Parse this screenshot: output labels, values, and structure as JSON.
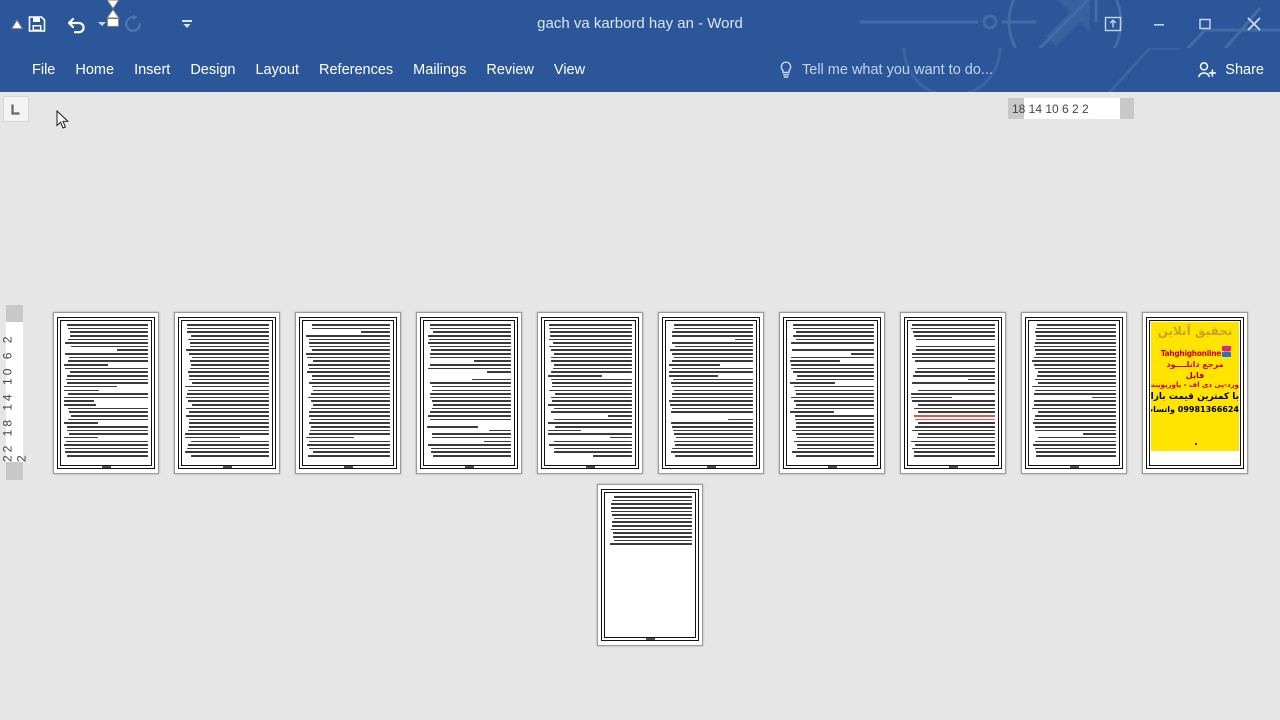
{
  "window": {
    "title": "gach va karbord hay an - Word",
    "accent_color": "#2b579a",
    "canvas_color": "#e6e6e6"
  },
  "quick_access": {
    "items": [
      {
        "name": "save-icon",
        "label": "Save",
        "enabled": true
      },
      {
        "name": "undo-icon",
        "label": "Undo",
        "enabled": true
      },
      {
        "name": "redo-icon",
        "label": "Redo",
        "enabled": false
      },
      {
        "name": "customize-quick-access-icon",
        "label": "Customize Quick Access Toolbar",
        "enabled": true
      }
    ]
  },
  "window_controls": [
    {
      "name": "ribbon-display-options-icon",
      "label": "Ribbon Display Options"
    },
    {
      "name": "minimize-icon",
      "label": "Minimize"
    },
    {
      "name": "restore-icon",
      "label": "Restore Down"
    },
    {
      "name": "close-icon",
      "label": "Close"
    }
  ],
  "ribbon": {
    "tabs": [
      {
        "label": "File"
      },
      {
        "label": "Home"
      },
      {
        "label": "Insert"
      },
      {
        "label": "Design"
      },
      {
        "label": "Layout"
      },
      {
        "label": "References"
      },
      {
        "label": "Mailings"
      },
      {
        "label": "Review"
      },
      {
        "label": "View"
      }
    ],
    "tell_me": "Tell me what you want to do...",
    "share_label": "Share"
  },
  "rulers": {
    "tab_selector": "Left Tab",
    "horizontal_numbers": "18  14  10   6    2    2",
    "vertical_numbers": "22 18 14 10  6   2   2"
  },
  "advert_page": {
    "title": "تحقیق آنلاین",
    "url": "Tahghighonline.ir",
    "line3": "مرجع دانلــــود",
    "line4": "فایل",
    "line5": "ورد-پی دی اف - پاورپوینت",
    "line6": "با کمترین قیمت بازار",
    "line7": "09981366624 واتساپ",
    "background": "#ffe400"
  },
  "pages": {
    "count": 11,
    "row1_count": 10,
    "row2_count": 1,
    "advert_index": 10
  }
}
